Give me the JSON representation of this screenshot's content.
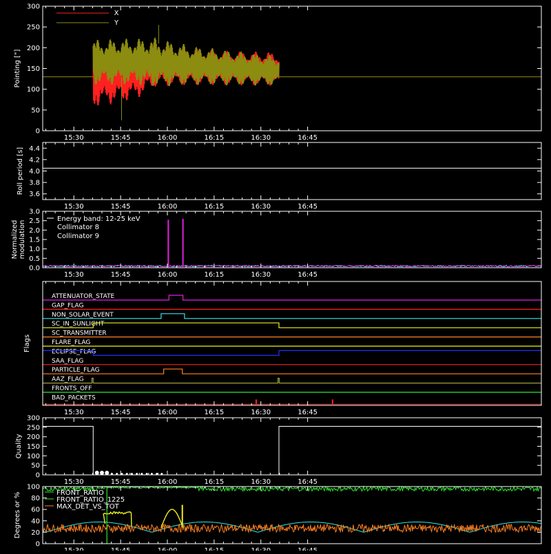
{
  "colors": {
    "red": "#ff2020",
    "olive": "#8c8c10",
    "white": "#ffffff",
    "cyan": "#30e8e8",
    "magenta": "#e020e0",
    "orange": "#ff8020",
    "yellow": "#f0f020",
    "blue": "#2030ff",
    "green": "#30e830",
    "tan": "#a0a040"
  },
  "chart_data": [
    {
      "type": "line",
      "id": "pointing",
      "ylabel": "Pointing [\"]",
      "ylim": [
        0,
        300
      ],
      "yticks": [
        0,
        50,
        100,
        150,
        200,
        250,
        300
      ],
      "xlim_min": [
        920,
        1080
      ],
      "xticks": [
        {
          "min": 930,
          "label": "15:30"
        },
        {
          "min": 945,
          "label": "15:45"
        },
        {
          "min": 960,
          "label": "16:00"
        },
        {
          "min": 975,
          "label": "16:15"
        },
        {
          "min": 990,
          "label": "16:30"
        },
        {
          "min": 1005,
          "label": "16:45"
        }
      ],
      "series": [
        {
          "name": "X",
          "color": "red"
        },
        {
          "name": "Y",
          "color": "olive"
        }
      ],
      "envelope": {
        "X": {
          "span": [
            936.2,
            995.8
          ],
          "max": [
            [
              936.2,
              200
            ],
            [
              956,
              205
            ],
            [
              968,
              195
            ],
            [
              995.8,
              190
            ]
          ],
          "min": [
            [
              936.2,
              55
            ],
            [
              950,
              75
            ],
            [
              956,
              105
            ],
            [
              968,
              110
            ],
            [
              995.8,
              108
            ]
          ]
        },
        "Y": {
          "span": [
            936.2,
            995.8
          ],
          "max": [
            [
              936.2,
              220
            ],
            [
              956,
              225
            ],
            [
              968,
              205
            ],
            [
              995.8,
              180
            ]
          ],
          "min": [
            [
              936.2,
              110
            ],
            [
              950,
              110
            ],
            [
              956,
              105
            ],
            [
              968,
              110
            ],
            [
              995.8,
              108
            ]
          ]
        }
      },
      "baseline": 130
    },
    {
      "type": "line",
      "id": "roll",
      "ylabel": "Roll period [s]",
      "ylim": [
        3.5,
        4.5
      ],
      "yticks": [
        3.6,
        3.8,
        4.0,
        4.2,
        4.4
      ],
      "ytick_labels": [
        "3.6",
        "3.8",
        "4.0",
        "4.2",
        "4.4"
      ],
      "series": [
        {
          "name": "",
          "color": "white",
          "value": 4.05
        }
      ]
    },
    {
      "type": "line",
      "id": "modulation",
      "ylabel": "Normalized modulation",
      "ylim": [
        0,
        3.0
      ],
      "yticks": [
        0,
        0.5,
        1.0,
        1.5,
        2.0,
        2.5,
        3.0
      ],
      "ytick_labels": [
        "0.0",
        "0.5",
        "1.0",
        "1.5",
        "2.0",
        "2.5",
        "3.0"
      ],
      "annotation": "Energy band: 12-25 keV",
      "series": [
        {
          "name": "Collimator 8",
          "color": "cyan"
        },
        {
          "name": "Collimator 9",
          "color": "magenta",
          "spikes": [
            [
              960.3,
              2.55
            ],
            [
              965.0,
              2.6
            ]
          ]
        }
      ]
    },
    {
      "type": "line",
      "id": "flags",
      "ylabel": "Flags",
      "flags": [
        {
          "name": "ATTENUATOR_STATE",
          "color": "magenta",
          "high": [
            [
              960.5,
              965
            ]
          ]
        },
        {
          "name": "GAP_FLAG",
          "color": "red",
          "high": []
        },
        {
          "name": "NON_SOLAR_EVENT",
          "color": "cyan",
          "high": [
            [
              958,
              965.5
            ]
          ]
        },
        {
          "name": "SC_IN_SUNLIGHT",
          "color": "yellow",
          "high": [
            [
              936.2,
              995.8
            ]
          ]
        },
        {
          "name": "SC_TRANSMITTER",
          "color": "orange",
          "high": []
        },
        {
          "name": "FLARE_FLAG",
          "color": "yellow",
          "high": []
        },
        {
          "name": "ECLIPSE_FLAG",
          "color": "blue",
          "high": [
            [
              920,
              936.2
            ],
            [
              995.8,
              1080
            ]
          ]
        },
        {
          "name": "SAA_FLAG",
          "color": "red",
          "high": []
        },
        {
          "name": "PARTICLE_FLAG",
          "color": "orange",
          "high": [
            [
              958.8,
              964.8
            ]
          ]
        },
        {
          "name": "AAZ_FLAG",
          "color": "tan",
          "high": [
            [
              935.8,
              936.2
            ],
            [
              995.5,
              995.9
            ]
          ]
        },
        {
          "name": "FRONTS_OFF",
          "color": "green",
          "high": []
        },
        {
          "name": "BAD_PACKETS",
          "color": "red",
          "spikes": [
            988.5,
            1013
          ]
        }
      ]
    },
    {
      "type": "line",
      "id": "quality",
      "ylabel": "Quality",
      "ylim": [
        0,
        300
      ],
      "yticks": [
        0,
        50,
        100,
        150,
        200,
        250,
        300
      ],
      "series": [
        {
          "name": "",
          "color": "white",
          "steps": [
            [
              920,
              255
            ],
            [
              936.2,
              0
            ],
            [
              995.8,
              255
            ],
            [
              1080,
              255
            ]
          ]
        }
      ]
    },
    {
      "type": "line",
      "id": "degrees",
      "ylabel": "Degrees or %",
      "ylim": [
        0,
        100
      ],
      "yticks": [
        0,
        20,
        40,
        60,
        80,
        100
      ],
      "series": [
        {
          "name": "FRONT_RATIO",
          "color": "green"
        },
        {
          "name": "FRONT_RATIO_1225",
          "color": "green"
        },
        {
          "name": "MAX_DET_VS_TOT",
          "color": "orange"
        }
      ]
    }
  ]
}
